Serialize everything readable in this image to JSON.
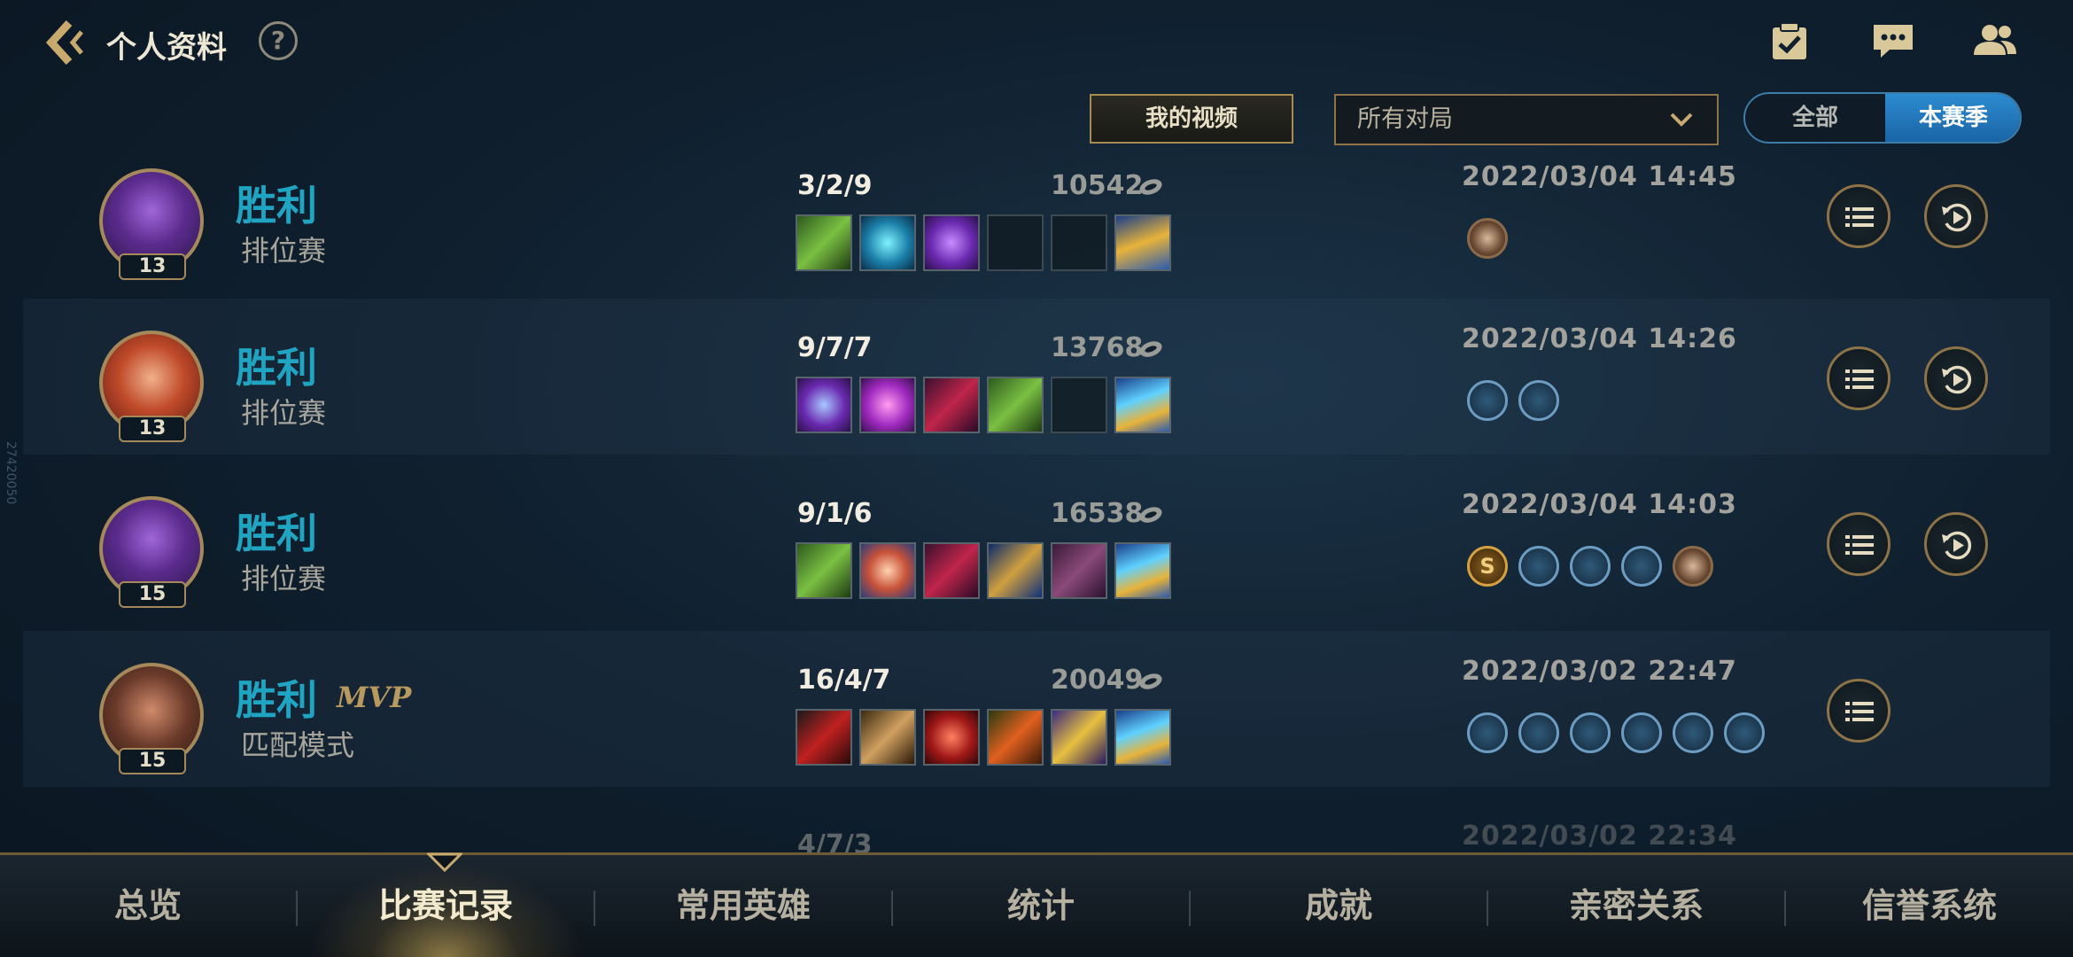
{
  "header": {
    "title": "个人资料",
    "help_label": "?"
  },
  "filters": {
    "my_videos": "我的视频",
    "game_filter": "所有对局",
    "toggle_all": "全部",
    "toggle_season": "本赛季"
  },
  "matches": [
    {
      "result": "胜利",
      "mode": "排位赛",
      "level": "13",
      "kda": "3/2/9",
      "gold": "10542",
      "date": "2022/03/04 14:45",
      "mvp": ""
    },
    {
      "result": "胜利",
      "mode": "排位赛",
      "level": "13",
      "kda": "9/7/7",
      "gold": "13768",
      "date": "2022/03/04 14:26",
      "mvp": ""
    },
    {
      "result": "胜利",
      "mode": "排位赛",
      "level": "15",
      "kda": "9/1/6",
      "gold": "16538",
      "date": "2022/03/04 14:03",
      "mvp": ""
    },
    {
      "result": "胜利",
      "mode": "匹配模式",
      "level": "15",
      "kda": "16/4/7",
      "gold": "20049",
      "date": "2022/03/02 22:47",
      "mvp": "MVP"
    },
    {
      "kda": "4/7/3",
      "date": "2022/03/02 22:34"
    }
  ],
  "badge_letter": "S",
  "side_id": "27420050",
  "nav": {
    "overview": "总览",
    "match_history": "比赛记录",
    "champions": "常用英雄",
    "stats": "统计",
    "achievements": "成就",
    "relations": "亲密关系",
    "honor": "信誉系统"
  },
  "colors": {
    "win": "#1fa5c2",
    "accent_gold": "#c8aa6e",
    "season_blue": "#2d8bd0"
  }
}
